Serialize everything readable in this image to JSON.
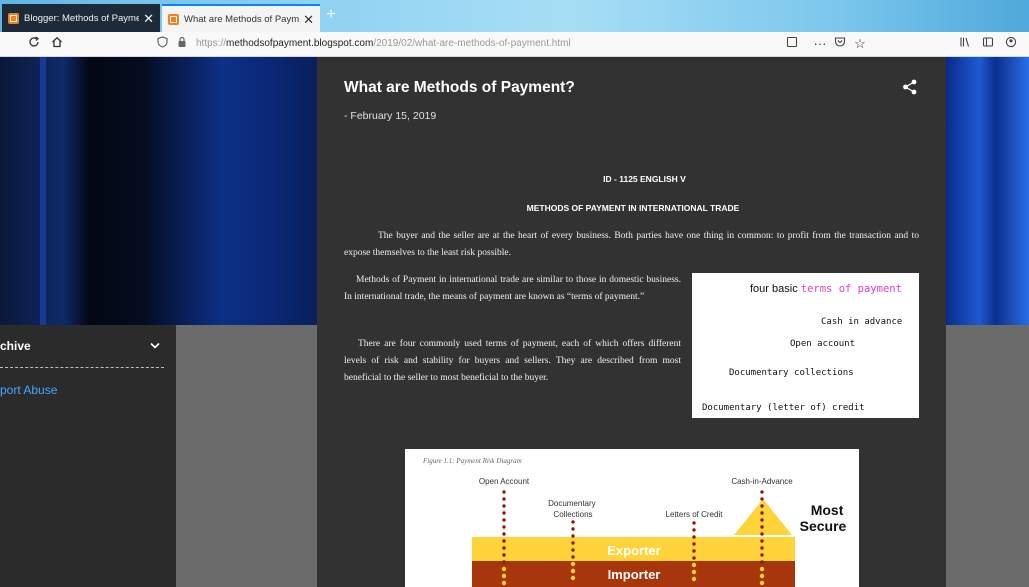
{
  "browser": {
    "tabs": [
      {
        "title": "Blogger: Methods of Payments",
        "active": false
      },
      {
        "title": "What are Methods of Payment?",
        "active": true
      }
    ],
    "url": {
      "host": "methodsofpayment.blogspot.com",
      "path": "/2019/02/what-are-methods-of-payment.html"
    }
  },
  "sidebar": {
    "archive_label": "chive",
    "report_label": "port Abuse"
  },
  "post": {
    "title": "What are Methods of Payment?",
    "date": "- February 15, 2019",
    "doc_id": "ID - 1125 ENGLISH V",
    "doc_heading": "METHODS OF PAYMENT IN INTERNATIONAL TRADE",
    "paragraphs": [
      "The buyer and the seller are at the heart of every business. Both parties have one thing in common: to profit from the transaction and to expose themselves to the least risk possible.",
      "Methods of Payment in international trade are similar to those in domestic business. In international trade, the means of payment are known as “terms of payment.”",
      "There are four commonly used terms of payment, each of which offers different levels of risk and stability for buyers and sellers. They are described from most beneficial to the seller to most beneficial to the buyer."
    ]
  },
  "terms_box": {
    "heading_prefix": "four basic",
    "heading_highlight": "terms of payment",
    "items": [
      "Cash in advance",
      "Open account",
      "Documentary collections",
      "Documentary (letter of) credit"
    ],
    "highlight_color": "#e040c8"
  },
  "diagram": {
    "caption": "Figure 1.1: Payment Risk Diagram",
    "columns": [
      "Open Account",
      "Documentary Collections",
      "Letters of Credit",
      "Cash-in-Advance"
    ],
    "secure_label": "Most Secure",
    "exporter_label": "Exporter",
    "importer_label": "Importer",
    "colors": {
      "exporter": "#ffd43b",
      "importer": "#a8360d",
      "dots": "#8a1d0a"
    }
  }
}
